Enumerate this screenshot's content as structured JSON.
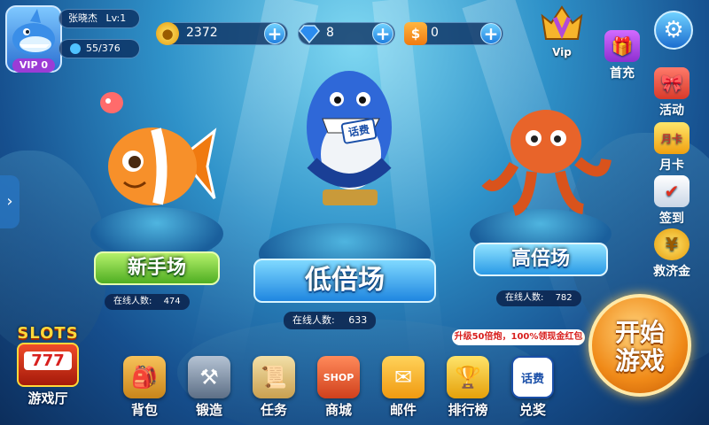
{
  "player": {
    "name": "张晓杰",
    "level": "Lv:1",
    "exp": "55/376",
    "vip": "VIP 0"
  },
  "currencies": [
    {
      "icon": "gold-coin-icon",
      "value": "2372"
    },
    {
      "icon": "diamond-icon",
      "value": "8"
    },
    {
      "icon": "coupon-icon",
      "value": "0"
    }
  ],
  "vip_badge": {
    "label": "Vip"
  },
  "side_menu": [
    {
      "label": "首充",
      "icon": "gift-icon"
    },
    {
      "label": "活动",
      "icon": "event-gift-icon"
    },
    {
      "label": "月卡",
      "icon": "month-card-icon"
    },
    {
      "label": "签到",
      "icon": "check-in-icon"
    },
    {
      "label": "救济金",
      "icon": "relief-coins-icon"
    }
  ],
  "rooms": [
    {
      "title": "新手场",
      "online_label": "在线人数:",
      "online": "474"
    },
    {
      "title": "低倍场",
      "online_label": "在线人数:",
      "online": "633"
    },
    {
      "title": "高倍场",
      "online_label": "在线人数:",
      "online": "782"
    }
  ],
  "shark_tag": "话费",
  "promo": "升级50倍炮，100%领现金红包",
  "start_button": {
    "line1": "开始",
    "line2": "游戏"
  },
  "slots": {
    "title": "SLOTS",
    "digits": "777",
    "label": "游戏厅"
  },
  "dock": [
    {
      "label": "背包",
      "icon": "backpack-icon"
    },
    {
      "label": "锻造",
      "icon": "anvil-icon"
    },
    {
      "label": "任务",
      "icon": "task-scroll-icon"
    },
    {
      "label": "商城",
      "icon": "shop-icon",
      "sign": "SHOP"
    },
    {
      "label": "邮件",
      "icon": "mail-icon"
    },
    {
      "label": "排行榜",
      "icon": "leaderboard-icon"
    },
    {
      "label": "兑奖",
      "icon": "redeem-icon",
      "sign": "话费"
    }
  ],
  "colors": {
    "accent_gold": "#f7b52c",
    "vip_purple": "#9b3cd6",
    "banner_green": "#8de04a",
    "banner_blue": "#3aa8f0"
  }
}
